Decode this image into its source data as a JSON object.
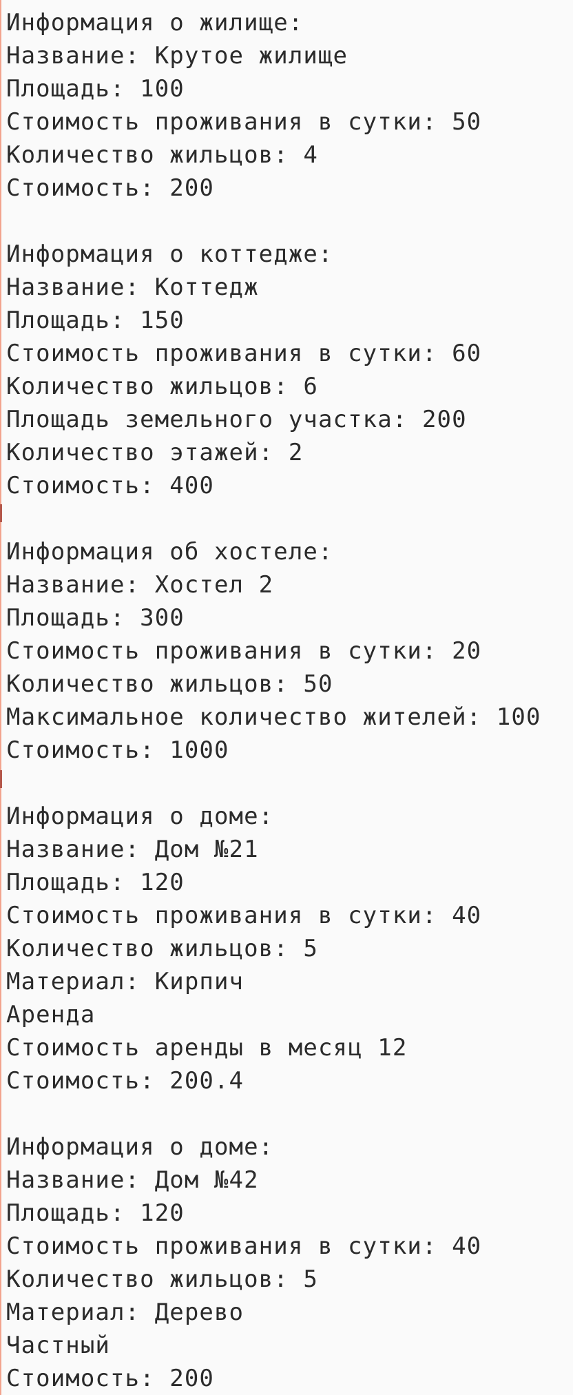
{
  "console": {
    "blocks": [
      {
        "lines": [
          "Информация о жилище:",
          "Название: Крутое жилище",
          "Площадь: 100",
          "Стоимость проживания в сутки: 50",
          "Количество жильцов: 4",
          "Стоимость: 200"
        ]
      },
      {
        "lines": [
          "Информация о коттедже:",
          "Название: Коттедж",
          "Площадь: 150",
          "Стоимость проживания в сутки: 60",
          "Количество жильцов: 6",
          "Площадь земельного участка: 200",
          "Количество этажей: 2",
          "Стоимость: 400"
        ]
      },
      {
        "lines": [
          "Информация об хостеле:",
          "Название: Хостел 2",
          "Площадь: 300",
          "Стоимость проживания в сутки: 20",
          "Количество жильцов: 50",
          "Максимальное количество жителей: 100",
          "Стоимость: 1000"
        ]
      },
      {
        "lines": [
          "Информация о доме:",
          "Название: Дом №21",
          "Площадь: 120",
          "Стоимость проживания в сутки: 40",
          "Количество жильцов: 5",
          "Материал: Кирпич",
          "Аренда",
          "Стоимость аренды в месяц 12",
          "Стоимость: 200.4"
        ]
      },
      {
        "lines": [
          "Информация о доме:",
          "Название: Дом №42",
          "Площадь: 120",
          "Стоимость проживания в сутки: 40",
          "Количество жильцов: 5",
          "Материал: Дерево",
          "Частный",
          "Стоимость: 200"
        ]
      }
    ]
  }
}
